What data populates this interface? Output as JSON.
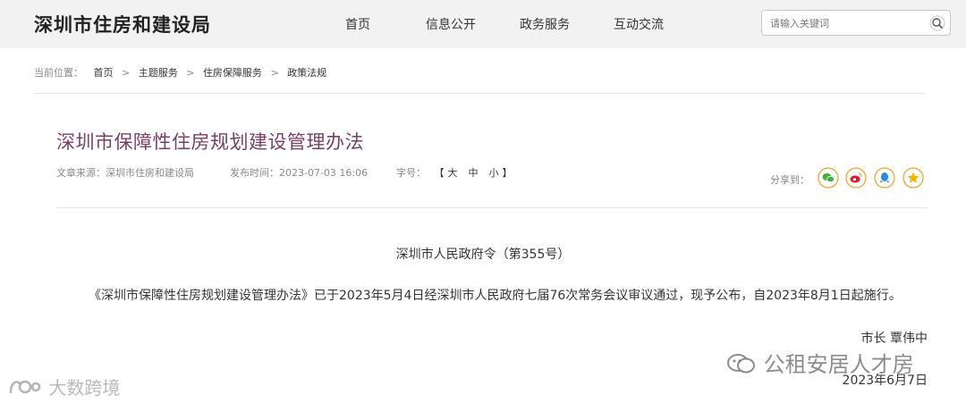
{
  "header": {
    "site_title": "深圳市住房和建设局",
    "nav": [
      {
        "label": "首页"
      },
      {
        "label": "信息公开"
      },
      {
        "label": "政务服务"
      },
      {
        "label": "互动交流"
      }
    ],
    "search": {
      "placeholder": "请输入关键词",
      "icon": "search-icon"
    }
  },
  "breadcrumb": {
    "prefix": "当前位置：",
    "items": [
      "首页",
      "主题服务",
      "住房保障服务",
      "政策法规"
    ],
    "separator": ">"
  },
  "article": {
    "title": "深圳市保障性住房规划建设管理办法",
    "source_label": "文章来源：",
    "source_value": "深圳市住房和建设局",
    "publish_label": "发布时间：",
    "publish_value": "2023-07-03 16:06",
    "font_label": "字号：",
    "font_open": "【",
    "font_sizes": [
      "大",
      "中",
      "小"
    ],
    "font_close": "】",
    "share_label": "分享到：",
    "share_icons": [
      {
        "name": "wechat-icon",
        "color": "#3fb03f"
      },
      {
        "name": "weibo-icon",
        "color": "#e6162d"
      },
      {
        "name": "qq-icon",
        "color": "#2e8bd8"
      },
      {
        "name": "qzone-icon",
        "color": "#f5b400"
      }
    ]
  },
  "content": {
    "decree": "深圳市人民政府令（第355号）",
    "paragraph": "《深圳市保障性住房规划建设管理办法》已于2023年5月4日经深圳市人民政府七届76次常务会议审议通过，现予公布，自2023年8月1日起施行。",
    "signer": "市长 覃伟中",
    "date": "2023年6月7日"
  },
  "watermarks": {
    "right": "公租安居人才房",
    "left": "大数跨境"
  }
}
